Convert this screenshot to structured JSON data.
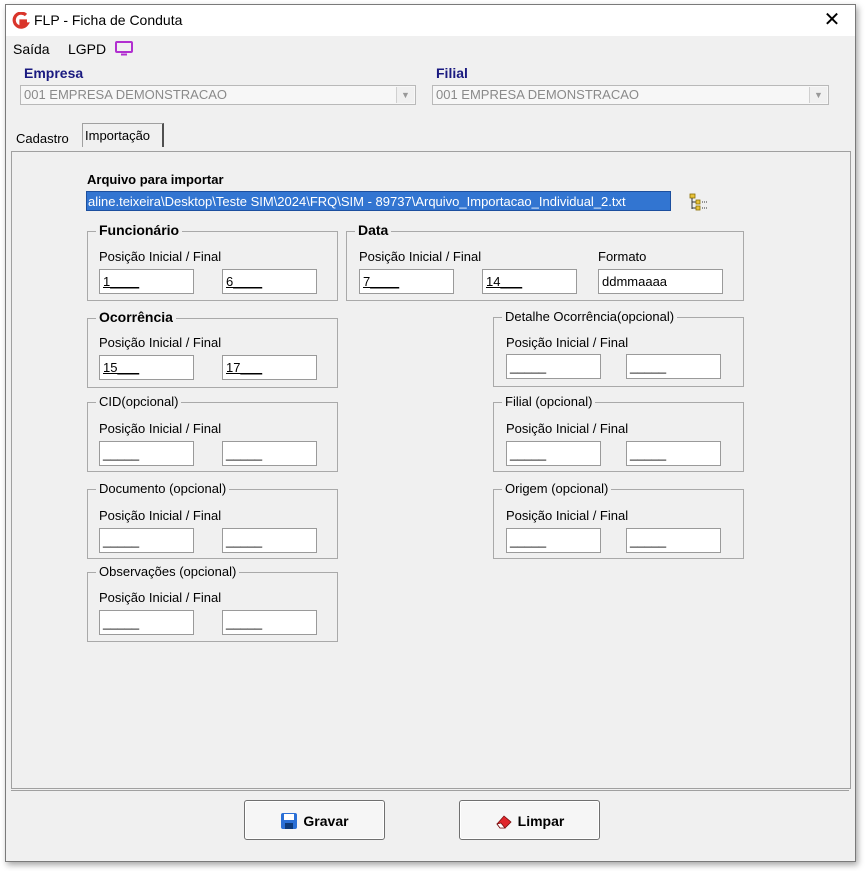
{
  "window": {
    "title": "FLP - Ficha de Conduta"
  },
  "menu": {
    "saida": "Saída",
    "lgpd": "LGPD"
  },
  "empresa": {
    "label": "Empresa",
    "value": "001 EMPRESA DEMONSTRACAO"
  },
  "filial": {
    "label": "Filial",
    "value": "001 EMPRESA DEMONSTRACAO"
  },
  "tabs": [
    {
      "label": "Cadastro"
    },
    {
      "label": "Importação"
    }
  ],
  "importacao": {
    "file_label": "Arquivo para importar",
    "file_path": "aline.teixeira\\Desktop\\Teste SIM\\2024\\FRQ\\SIM - 89737\\Arquivo_Importacao_Individual_2.txt",
    "range_label": "Posição Inicial / Final",
    "funcionario": {
      "title": "Funcionário",
      "start": "1____",
      "end": "6____"
    },
    "data": {
      "title": "Data",
      "start": "7____",
      "end": "14___",
      "format_label": "Formato",
      "format": "ddmmaaaa"
    },
    "ocorrencia": {
      "title": "Ocorrência",
      "start": "15___",
      "end": "17___"
    },
    "detalhe": {
      "title": "Detalhe Ocorrência(opcional)",
      "start": "_____",
      "end": "_____"
    },
    "cid": {
      "title": "CID(opcional)",
      "start": "_____",
      "end": "_____"
    },
    "filial_opc": {
      "title": "Filial (opcional)",
      "start": "_____",
      "end": "_____"
    },
    "documento": {
      "title": "Documento (opcional)",
      "start": "_____",
      "end": "_____"
    },
    "origem": {
      "title": "Origem (opcional)",
      "start": "_____",
      "end": "_____"
    },
    "observacoes": {
      "title": "Observações (opcional)",
      "start": "_____",
      "end": "_____"
    }
  },
  "buttons": {
    "gravar": "Gravar",
    "limpar": "Limpar"
  },
  "colors": {
    "selection": "#3275d1",
    "label_blue": "#1a1a80",
    "logo_red": "#d9352b",
    "lgpd_purple": "#b12fd0"
  }
}
